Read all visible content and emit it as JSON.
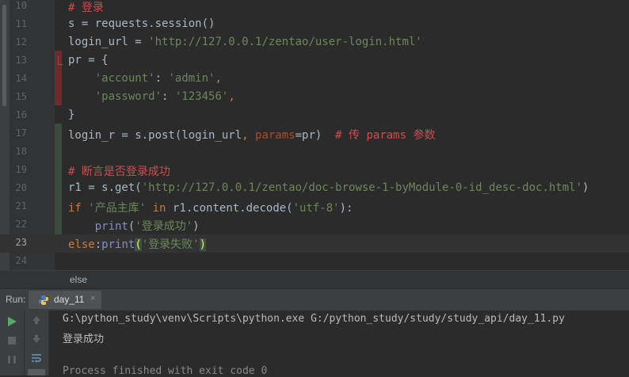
{
  "editor": {
    "lines": [
      {
        "num": "10",
        "tokens": [
          {
            "t": "# 登录",
            "c": "cm"
          }
        ]
      },
      {
        "num": "11",
        "tokens": [
          {
            "t": "s = requests.session()",
            "c": "ident"
          }
        ]
      },
      {
        "num": "12",
        "tokens": [
          {
            "t": "login_url = ",
            "c": "ident"
          },
          {
            "t": "'http://127.0.0.1/zentao/user-login.html'",
            "c": "str"
          }
        ]
      },
      {
        "num": "13",
        "tokens": [
          {
            "t": "pr = {",
            "c": "ident"
          }
        ]
      },
      {
        "num": "14",
        "tokens": [
          {
            "t": "    'account'",
            "c": "str"
          },
          {
            "t": ": ",
            "c": "ident"
          },
          {
            "t": "'admin'",
            "c": "str"
          },
          {
            "t": ",",
            "c": "kw"
          }
        ]
      },
      {
        "num": "15",
        "tokens": [
          {
            "t": "    'password'",
            "c": "str"
          },
          {
            "t": ": ",
            "c": "ident"
          },
          {
            "t": "'123456'",
            "c": "str"
          },
          {
            "t": ",",
            "c": "kw"
          }
        ]
      },
      {
        "num": "16",
        "tokens": [
          {
            "t": "}",
            "c": "ident"
          }
        ]
      },
      {
        "num": "17",
        "tokens": [
          {
            "t": "login_r = s.post(login_url",
            "c": "ident"
          },
          {
            "t": ", ",
            "c": "kw"
          },
          {
            "t": "params",
            "c": "param"
          },
          {
            "t": "=pr)  ",
            "c": "ident"
          },
          {
            "t": "# 传 params 参数",
            "c": "cm"
          }
        ]
      },
      {
        "num": "18",
        "tokens": []
      },
      {
        "num": "19",
        "tokens": [
          {
            "t": "# 断言是否登录成功",
            "c": "cm"
          }
        ]
      },
      {
        "num": "20",
        "tokens": [
          {
            "t": "r1 = s.get(",
            "c": "ident"
          },
          {
            "t": "'http://127.0.0.1/zentao/doc-browse-1-byModule-0-id_desc-doc.html'",
            "c": "str"
          },
          {
            "t": ")",
            "c": "ident"
          }
        ]
      },
      {
        "num": "21",
        "tokens": [
          {
            "t": "if ",
            "c": "kw"
          },
          {
            "t": "'产品主库' ",
            "c": "str"
          },
          {
            "t": "in ",
            "c": "kw"
          },
          {
            "t": "r1.content.decode(",
            "c": "ident"
          },
          {
            "t": "'utf-8'",
            "c": "str"
          },
          {
            "t": "):",
            "c": "ident"
          }
        ]
      },
      {
        "num": "22",
        "tokens": [
          {
            "t": "    ",
            "c": "ident"
          },
          {
            "t": "print",
            "c": "fn"
          },
          {
            "t": "(",
            "c": "ident"
          },
          {
            "t": "'登录成功'",
            "c": "str"
          },
          {
            "t": ")",
            "c": "ident"
          }
        ]
      },
      {
        "num": "23",
        "tokens": [
          {
            "t": "else",
            "c": "kw"
          },
          {
            "t": ":",
            "c": "ident"
          },
          {
            "t": "print",
            "c": "fn"
          },
          {
            "t": "(",
            "c": "brk-hl"
          },
          {
            "t": "'登录失败'",
            "c": "str"
          },
          {
            "t": ")",
            "c": "brk-hl"
          }
        ]
      },
      {
        "num": "24",
        "tokens": []
      }
    ],
    "current_line": "23"
  },
  "hint_text": "else",
  "run_panel": {
    "label": "Run:",
    "tab_name": "day_11",
    "tab_close": "×",
    "output": [
      "G:\\python_study\\venv\\Scripts\\python.exe G:/python_study/study/study_api/day_11.py",
      "登录成功",
      "",
      "Process finished with exit code 0"
    ]
  },
  "colors": {
    "background": "#2b2b2b",
    "keyword": "#cc7832",
    "string": "#6a8759",
    "comment": "#cc4c4c",
    "builtin": "#8888c6",
    "run_icon": "#59a869"
  },
  "icons": {
    "run": "play-icon",
    "stop": "stop-icon",
    "pause": "pause-icon",
    "up": "arrow-up-icon",
    "down": "arrow-down-icon",
    "wrap": "soft-wrap-icon",
    "python": "python-icon"
  }
}
